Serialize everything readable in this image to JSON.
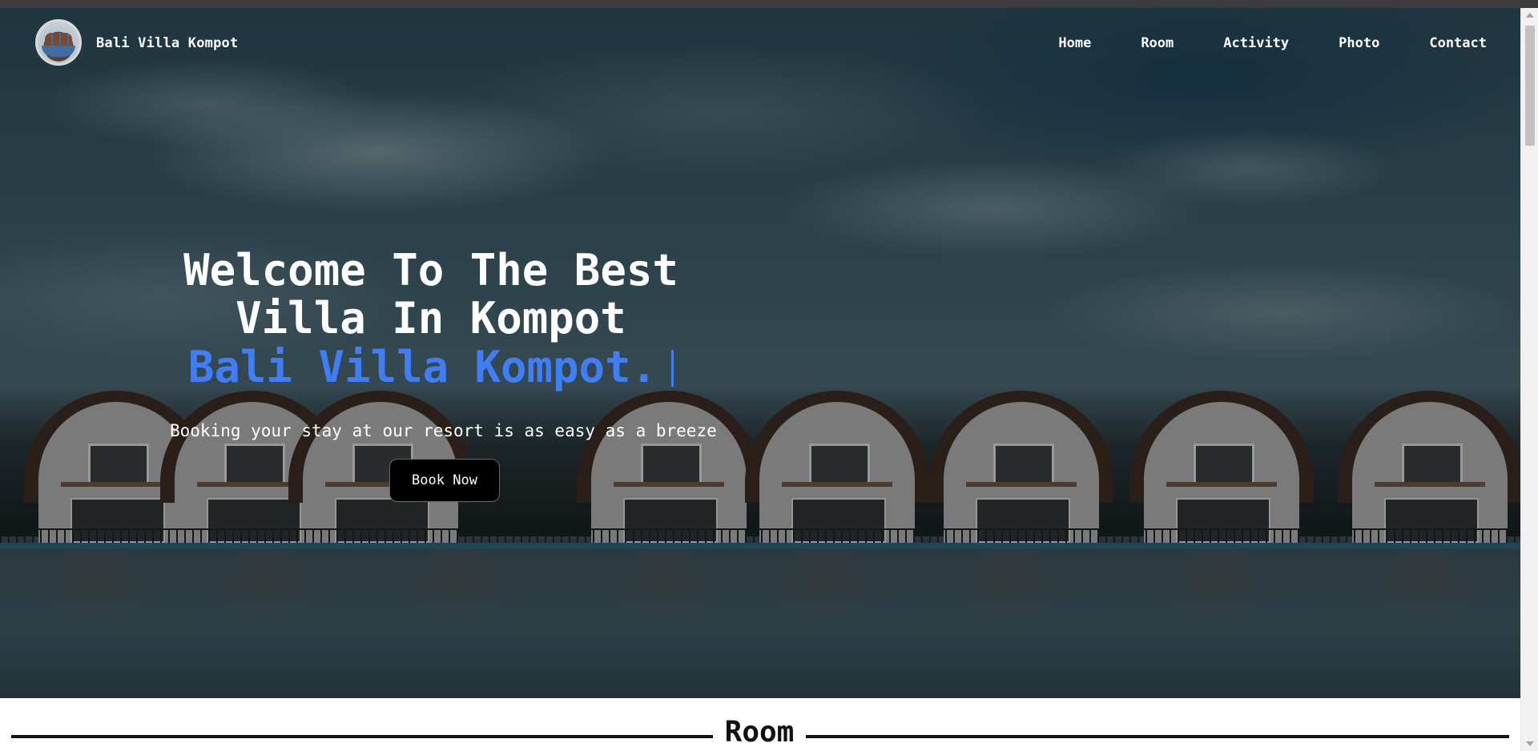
{
  "nav": {
    "brand": "Bali Villa Kompot",
    "links": [
      "Home",
      "Room",
      "Activity",
      "Photo",
      "Contact"
    ]
  },
  "hero": {
    "title_line1": "Welcome To The Best",
    "title_line2": "Villa In Kompot",
    "highlight": "Bali Villa Kompot.",
    "subtitle": "Booking your stay at our resort is as easy as a breeze",
    "cta_label": "Book Now"
  },
  "room_section": {
    "heading": "Room"
  },
  "colors": {
    "accent": "#3f7ef7",
    "button_bg": "#000000",
    "text_light": "#ffffff"
  },
  "icons": {
    "logo": "villa-logo-icon"
  }
}
